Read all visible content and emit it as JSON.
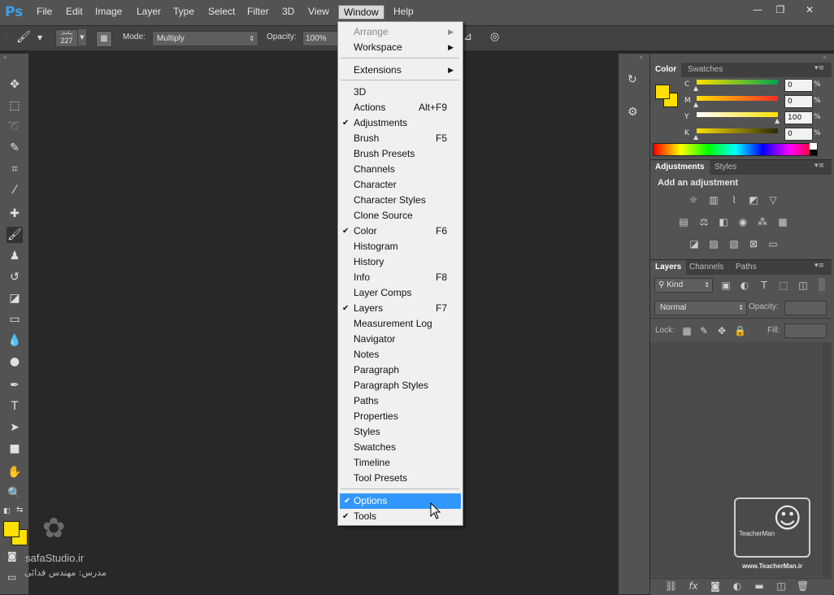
{
  "app": {
    "logo": "Ps"
  },
  "menubar": {
    "items": [
      "File",
      "Edit",
      "Image",
      "Layer",
      "Type",
      "Select",
      "Filter",
      "3D",
      "View",
      "Window",
      "Help"
    ],
    "window_controls": [
      "—",
      "❐",
      "✕"
    ]
  },
  "options": {
    "brush_size_label": "پیکسل",
    "brush_size": "227",
    "mode_label": "Mode:",
    "mode_value": "Multiply",
    "opacity_label": "Opacity:",
    "opacity_value": "100%"
  },
  "window_menu": {
    "items": [
      {
        "label": "Arrange",
        "shortcut": "",
        "checked": false,
        "submenu": true,
        "disabled": true
      },
      {
        "label": "Workspace",
        "shortcut": "",
        "checked": false,
        "submenu": true,
        "disabled": false
      },
      {
        "label": "Extensions",
        "shortcut": "",
        "checked": false,
        "submenu": true,
        "disabled": false
      },
      {
        "label": "3D",
        "shortcut": "",
        "checked": false
      },
      {
        "label": "Actions",
        "shortcut": "Alt+F9",
        "checked": false
      },
      {
        "label": "Adjustments",
        "shortcut": "",
        "checked": true
      },
      {
        "label": "Brush",
        "shortcut": "F5",
        "checked": false
      },
      {
        "label": "Brush Presets",
        "shortcut": "",
        "checked": false
      },
      {
        "label": "Channels",
        "shortcut": "",
        "checked": false
      },
      {
        "label": "Character",
        "shortcut": "",
        "checked": false
      },
      {
        "label": "Character Styles",
        "shortcut": "",
        "checked": false
      },
      {
        "label": "Clone Source",
        "shortcut": "",
        "checked": false
      },
      {
        "label": "Color",
        "shortcut": "F6",
        "checked": true
      },
      {
        "label": "Histogram",
        "shortcut": "",
        "checked": false
      },
      {
        "label": "History",
        "shortcut": "",
        "checked": false
      },
      {
        "label": "Info",
        "shortcut": "F8",
        "checked": false
      },
      {
        "label": "Layer Comps",
        "shortcut": "",
        "checked": false
      },
      {
        "label": "Layers",
        "shortcut": "F7",
        "checked": true
      },
      {
        "label": "Measurement Log",
        "shortcut": "",
        "checked": false
      },
      {
        "label": "Navigator",
        "shortcut": "",
        "checked": false
      },
      {
        "label": "Notes",
        "shortcut": "",
        "checked": false
      },
      {
        "label": "Paragraph",
        "shortcut": "",
        "checked": false
      },
      {
        "label": "Paragraph Styles",
        "shortcut": "",
        "checked": false
      },
      {
        "label": "Paths",
        "shortcut": "",
        "checked": false
      },
      {
        "label": "Properties",
        "shortcut": "",
        "checked": false
      },
      {
        "label": "Styles",
        "shortcut": "",
        "checked": false
      },
      {
        "label": "Swatches",
        "shortcut": "",
        "checked": false
      },
      {
        "label": "Timeline",
        "shortcut": "",
        "checked": false
      },
      {
        "label": "Tool Presets",
        "shortcut": "",
        "checked": false
      },
      {
        "label": "Options",
        "shortcut": "",
        "checked": true,
        "highlighted": true
      },
      {
        "label": "Tools",
        "shortcut": "",
        "checked": true
      }
    ]
  },
  "color_panel": {
    "tabs": [
      "Color",
      "Swatches"
    ],
    "channels": [
      {
        "label": "C",
        "value": "0"
      },
      {
        "label": "M",
        "value": "0"
      },
      {
        "label": "Y",
        "value": "100"
      },
      {
        "label": "K",
        "value": "0"
      }
    ],
    "unit": "%",
    "fg_color": "#ffe000",
    "bg_color": "#ffe000"
  },
  "adjustments_panel": {
    "tabs": [
      "Adjustments",
      "Styles"
    ],
    "heading": "Add an adjustment"
  },
  "layers_panel": {
    "tabs": [
      "Layers",
      "Channels",
      "Paths"
    ],
    "filter_kind": "Kind",
    "blend_mode": "Normal",
    "opacity_label": "Opacity:",
    "lock_label": "Lock:",
    "fill_label": "Fill:"
  },
  "watermarks": {
    "left_site": "safaStudio.ir",
    "left_teacher": "مدرس: مهندس فدائی",
    "right_logo_text": "TeacherMan",
    "right_site": "www.TeacherMan.ir"
  }
}
